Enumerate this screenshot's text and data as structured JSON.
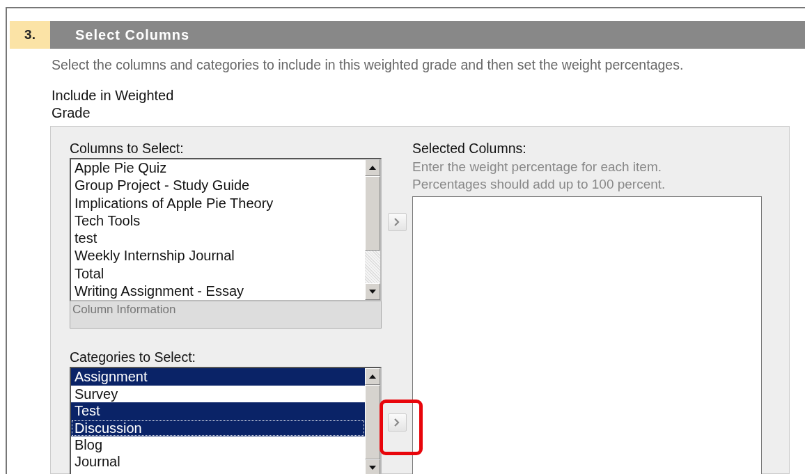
{
  "step": {
    "number": "3.",
    "title": "Select Columns"
  },
  "description": "Select the columns and categories to include in this weighted grade and then set the weight percentages.",
  "field_label": "Include in Weighted Grade",
  "columns_to_select": {
    "label": "Columns to Select:",
    "items": [
      {
        "label": "Apple Pie Quiz",
        "selected": false
      },
      {
        "label": "Group Project - Study Guide",
        "selected": false
      },
      {
        "label": "Implications of Apple Pie Theory",
        "selected": false
      },
      {
        "label": "Tech Tools",
        "selected": false
      },
      {
        "label": "test",
        "selected": false
      },
      {
        "label": "Weekly Internship Journal",
        "selected": false
      },
      {
        "label": "Total",
        "selected": false
      },
      {
        "label": "Writing Assignment - Essay",
        "selected": false
      }
    ],
    "info": "Column Information"
  },
  "categories_to_select": {
    "label": "Categories to Select:",
    "items": [
      {
        "label": "Assignment",
        "selected": true
      },
      {
        "label": "Survey",
        "selected": false
      },
      {
        "label": "Test",
        "selected": true
      },
      {
        "label": "Discussion",
        "selected": true
      },
      {
        "label": "Blog",
        "selected": false
      },
      {
        "label": "Journal",
        "selected": false
      }
    ],
    "highlighted": true
  },
  "selected_columns": {
    "label": "Selected Columns:",
    "hints": [
      "Enter the weight percentage for each item.",
      "Percentages should add up to 100 percent."
    ]
  }
}
